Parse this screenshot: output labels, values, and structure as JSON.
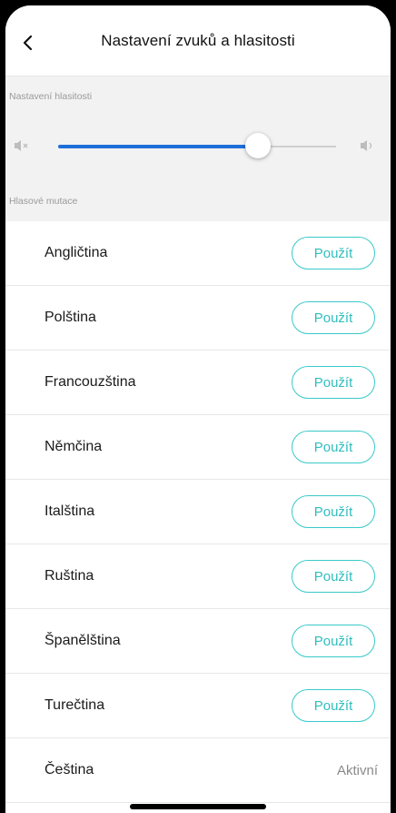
{
  "header": {
    "title": "Nastavení zvuků a hlasitosti"
  },
  "volume": {
    "section_label": "Nastavení hlasitosti",
    "level_percent": 72,
    "accent_color": "#1e6fd9"
  },
  "voices": {
    "section_label": "Hlasové mutace",
    "button_color": "#3ac9c9",
    "items": [
      {
        "name": "Angličtina",
        "action": "Použít"
      },
      {
        "name": "Polština",
        "action": "Použít"
      },
      {
        "name": "Francouzština",
        "action": "Použít"
      },
      {
        "name": "Němčina",
        "action": "Použít"
      },
      {
        "name": "Italština",
        "action": "Použít"
      },
      {
        "name": "Ruština",
        "action": "Použít"
      },
      {
        "name": "Španělština",
        "action": "Použít"
      },
      {
        "name": "Turečtina",
        "action": "Použít"
      },
      {
        "name": "Čeština",
        "status": "Aktivní"
      }
    ]
  },
  "icons": {
    "back": "chevron-left-icon",
    "volume_min": "speaker-mute-icon",
    "volume_max": "speaker-loud-icon"
  }
}
